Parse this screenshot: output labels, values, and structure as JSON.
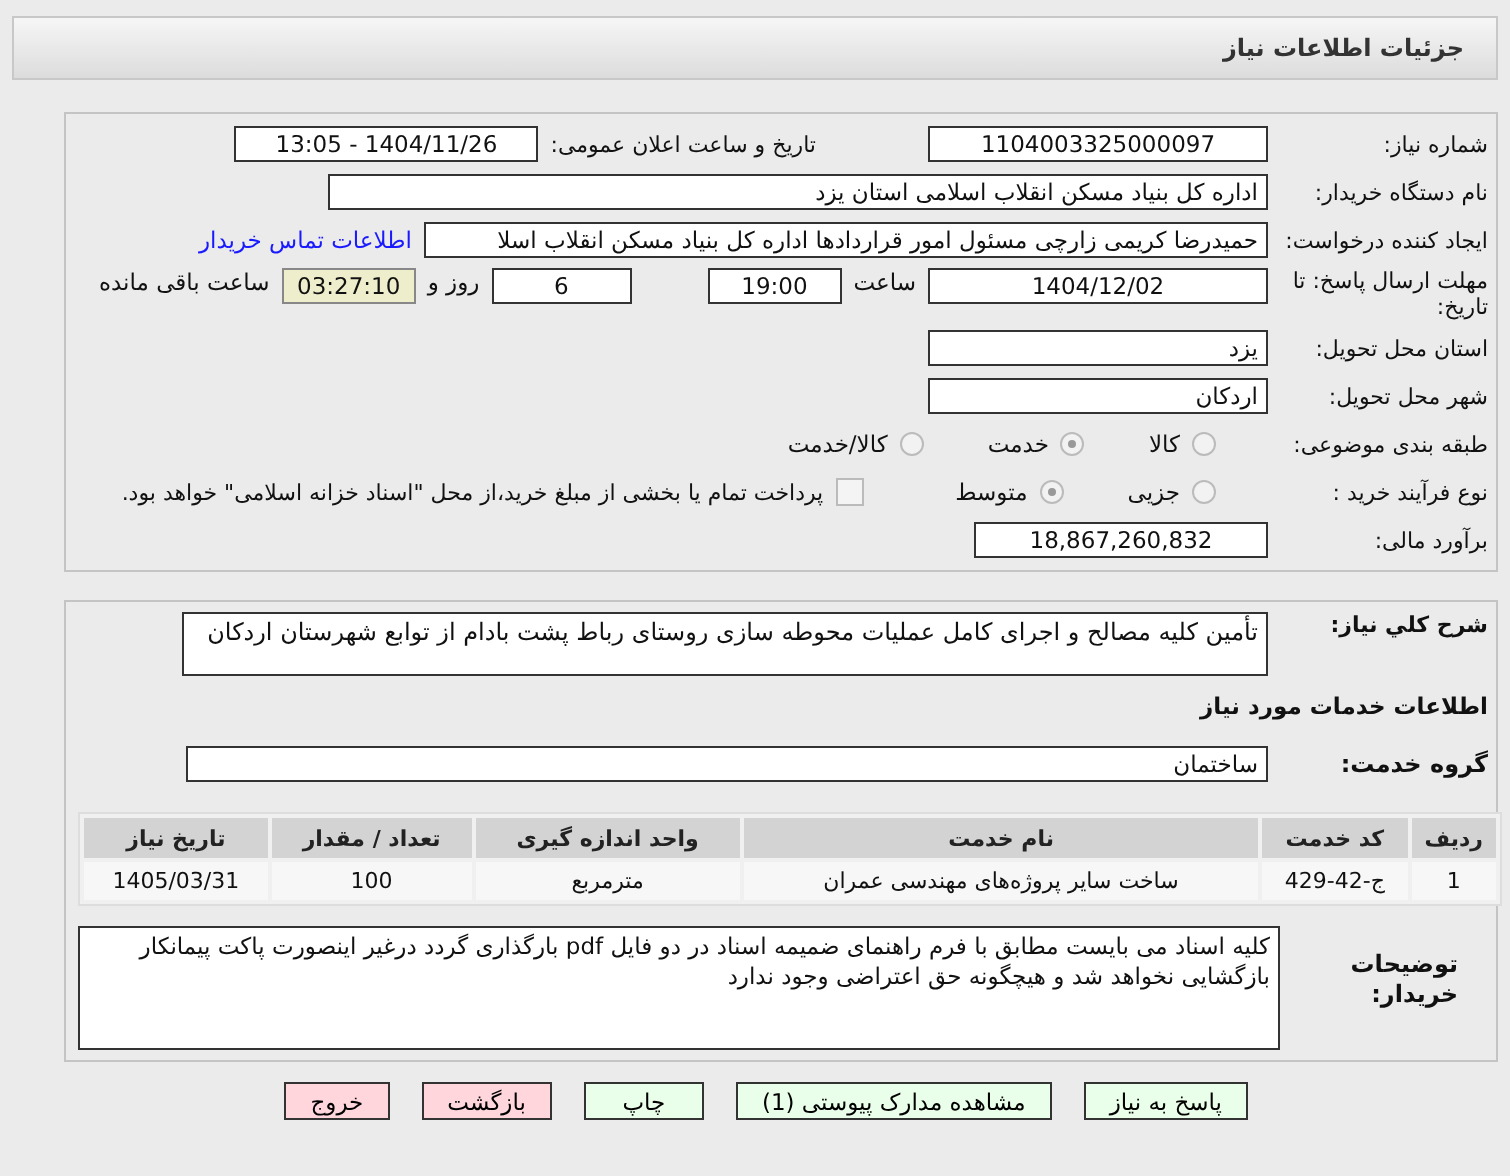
{
  "header": {
    "title": "جزئیات اطلاعات نیاز"
  },
  "need_number": {
    "label": "شماره نیاز:",
    "value": "1104003325000097"
  },
  "announce": {
    "label": "تاریخ و ساعت اعلان عمومی:",
    "value": "1404/11/26 - 13:05"
  },
  "buyer_org": {
    "label": "نام دستگاه خریدار:",
    "value": "اداره کل بنیاد مسکن انقلاب اسلامی استان یزد"
  },
  "requester": {
    "label": "ایجاد کننده درخواست:",
    "value": "حمیدرضا کریمی زارچی مسئول امور قراردادها اداره کل بنیاد مسکن انقلاب اسلا",
    "link": "اطلاعات تماس خریدار"
  },
  "deadline": {
    "label": "مهلت ارسال پاسخ: تا تاریخ:",
    "date": "1404/12/02",
    "time_label": "ساعت",
    "time": "19:00",
    "days": "6",
    "days_label": "روز و",
    "remaining": "03:27:10",
    "remaining_label": "ساعت باقی مانده"
  },
  "province": {
    "label": "استان محل تحویل:",
    "value": "یزد"
  },
  "city": {
    "label": "شهر محل تحویل:",
    "value": "اردکان"
  },
  "category": {
    "label": "طبقه بندی موضوعی:",
    "options": [
      {
        "label": "کالا",
        "selected": false
      },
      {
        "label": "خدمت",
        "selected": true
      },
      {
        "label": "کالا/خدمت",
        "selected": false
      }
    ]
  },
  "process": {
    "label": "نوع فرآیند خرید :",
    "options": [
      {
        "label": "جزیی",
        "selected": false
      },
      {
        "label": "متوسط",
        "selected": true
      }
    ],
    "payment_checked": false,
    "payment_note": "پرداخت تمام یا بخشی از مبلغ خرید،از محل \"اسناد خزانه اسلامی\" خواهد بود."
  },
  "budget": {
    "label": "برآورد مالی:",
    "value": "18,867,260,832"
  },
  "description": {
    "label": "شرح کلي نياز:",
    "value": "تأمین کلیه مصالح و اجرای کامل عملیات محوطه سازی روستای رباط پشت بادام از توابع شهرستان اردکان"
  },
  "services_title": "اطلاعات خدمات مورد نیاز",
  "service_group": {
    "label": "گروه خدمت:",
    "value": "ساختمان"
  },
  "table": {
    "columns": [
      "ردیف",
      "کد خدمت",
      "نام خدمت",
      "واحد اندازه گیری",
      "تعداد / مقدار",
      "تاریخ نیاز"
    ],
    "rows": [
      [
        "1",
        "ج-42-429",
        "ساخت سایر پروژه‌های مهندسی عمران",
        "مترمربع",
        "100",
        "1405/03/31"
      ]
    ]
  },
  "buyer_notes": {
    "label": "توضیحات خریدار:",
    "value": "کلیه اسناد می بایست مطابق با فرم راهنمای ضمیمه اسناد در دو فایل pdf بارگذاری گردد درغیر اینصورت  پاکت پیمانکار بازگشایی نخواهد شد و هیچگونه حق اعتراضی وجود ندارد"
  },
  "buttons": [
    {
      "label": "پاسخ به نیاز",
      "kind": "action"
    },
    {
      "label": "مشاهده مدارک پیوستی (1)",
      "kind": "action"
    },
    {
      "label": "چاپ",
      "kind": "action"
    },
    {
      "label": "بازگشت",
      "kind": "exit"
    },
    {
      "label": "خروج",
      "kind": "exit"
    }
  ]
}
